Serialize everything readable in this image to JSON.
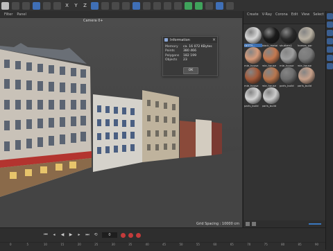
{
  "toolbar": {
    "icons": [
      "undo-icon",
      "redo-icon",
      "cursor-icon",
      "move-icon",
      "scale-icon",
      "rotate-icon",
      "x-axis",
      "y-axis",
      "z-axis",
      "coordinate-icon",
      "render-view-icon",
      "render-icon",
      "render-settings-icon",
      "cube-icon",
      "pen-icon",
      "subdivide-icon",
      "spline-icon",
      "arrow-icon",
      "light-icon",
      "camera-icon",
      "texture-icon",
      "globe-icon",
      "shape-icon"
    ],
    "axis_x": "X",
    "axis_y": "Y",
    "axis_z": "Z"
  },
  "menu": {
    "filter": "Filter",
    "panel": "Panel"
  },
  "viewport": {
    "camera_label": "Camera 0+",
    "grid_spacing": "Grid Spacing : 10000 cm"
  },
  "material_panel": {
    "menu": [
      "Create",
      "V-Ray",
      "Corona",
      "Edit",
      "View",
      "Select"
    ],
    "materials": [
      {
        "label": "GETTY...",
        "color": "#d7d7d7",
        "selected": true
      },
      {
        "label": "black_metal",
        "color": "#1b1b1b"
      },
      {
        "label": "shutters1",
        "color": "#2a2a2a"
      },
      {
        "label": "frames_par",
        "color": "#b9b1a3"
      },
      {
        "label": "mie_house",
        "color": "#d59a7a"
      },
      {
        "label": "mie_house",
        "color": "#c4784f"
      },
      {
        "label": "mie_house",
        "color": "#9f9f9f"
      },
      {
        "label": "mie_house",
        "color": "#7a7a7a"
      },
      {
        "label": "mie_house",
        "color": "#a45a3a"
      },
      {
        "label": "mie_house",
        "color": "#b8764e"
      },
      {
        "label": "paris_build",
        "color": "#6d6d6d"
      },
      {
        "label": "paris_build",
        "color": "#c6a08a"
      },
      {
        "label": "paris_build",
        "color": "#d4d4d4"
      },
      {
        "label": "paris_build",
        "color": "#cbcbcb"
      }
    ]
  },
  "info_dialog": {
    "title": "Information",
    "rows": [
      {
        "key": "Memory",
        "value": "ca. 16 072 KBytes"
      },
      {
        "key": "Points",
        "value": "380 466"
      },
      {
        "key": "Polygons",
        "value": "182 199"
      },
      {
        "key": "Objects",
        "value": "23"
      }
    ],
    "ok": "OK"
  },
  "timeline": {
    "current_frame": "0",
    "ticks": [
      "0",
      "5",
      "10",
      "15",
      "20",
      "25",
      "30",
      "35",
      "40",
      "45",
      "50",
      "55",
      "60",
      "65",
      "70",
      "75",
      "80",
      "85",
      "90"
    ]
  },
  "colors": {
    "accent": "#3d6fb0",
    "record": "#c43b3b"
  }
}
